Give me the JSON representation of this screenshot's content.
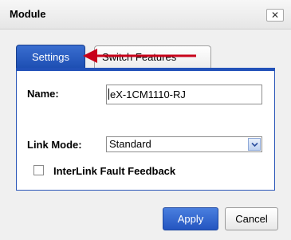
{
  "dialog": {
    "title": "Module",
    "close_label": "✕"
  },
  "tabs": [
    {
      "label": "Settings",
      "active": true
    },
    {
      "label": "Switch Features",
      "active": false
    }
  ],
  "form": {
    "name_label": "Name:",
    "name_value": "eX-1CM1110-RJ",
    "link_mode_label": "Link Mode:",
    "link_mode_value": "Standard",
    "interlink_label": "InterLink Fault Feedback",
    "interlink_checked": false
  },
  "buttons": {
    "apply": "Apply",
    "cancel": "Cancel"
  },
  "colors": {
    "accent": "#2251b8",
    "annotation_arrow": "#c8001a"
  },
  "icons": {
    "close": "close-icon",
    "dropdown": "chevron-down-icon",
    "annotation": "arrow-left-icon"
  }
}
